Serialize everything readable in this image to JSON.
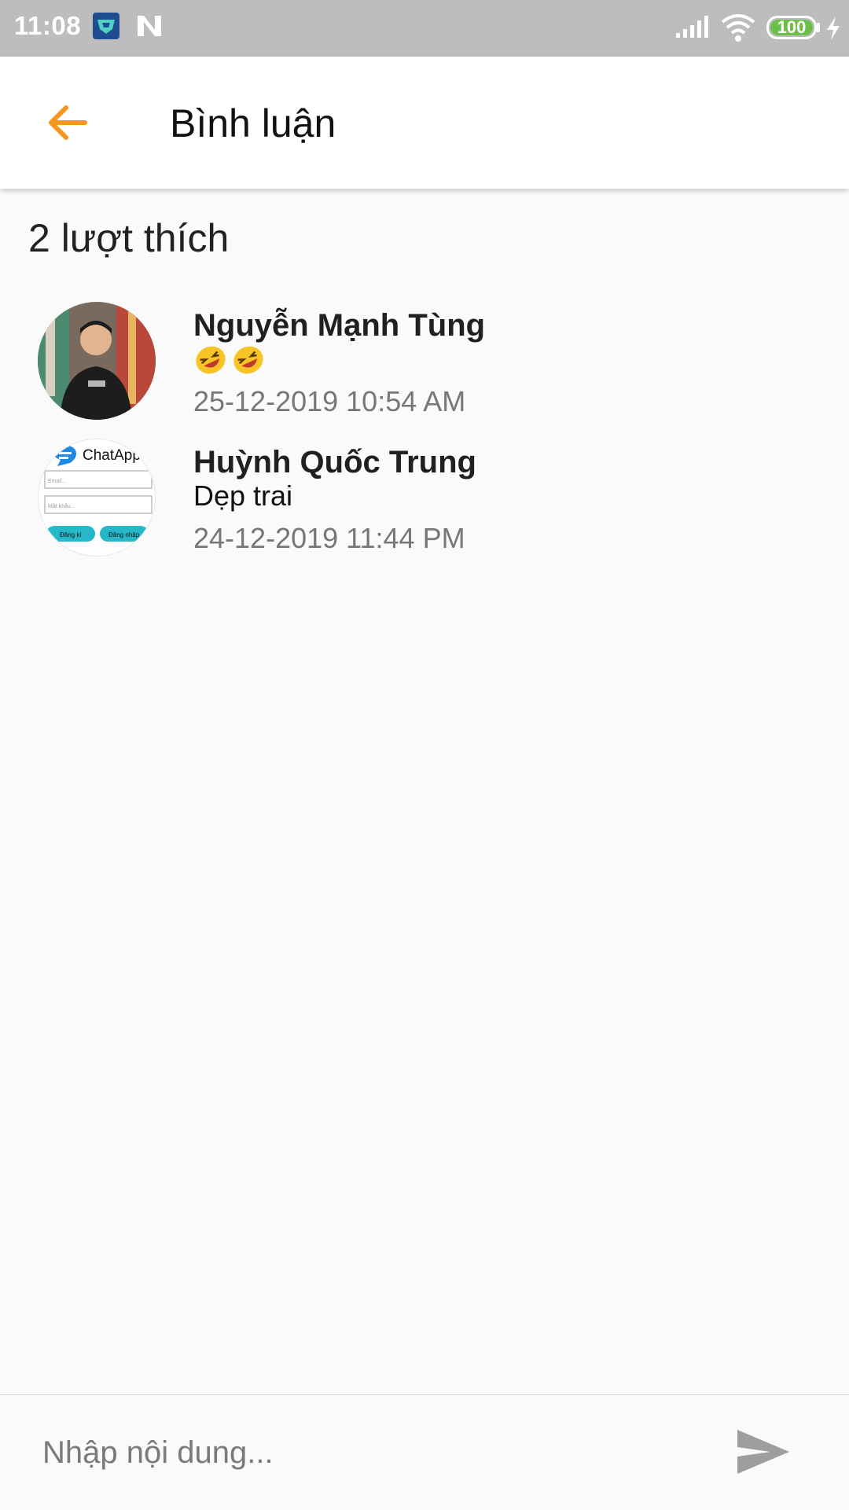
{
  "status_bar": {
    "time": "11:08",
    "battery": "100",
    "icons": [
      "app-icon",
      "n-icon",
      "signal-icon",
      "wifi-icon",
      "battery-icon",
      "charging-bolt-icon"
    ]
  },
  "header": {
    "title": "Bình luận",
    "back_icon": "arrow-left-icon",
    "accent_color": "#f5961e"
  },
  "likes": {
    "label": "2 lượt thích"
  },
  "comments": [
    {
      "name": "Nguyễn Mạnh Tùng",
      "text": "🤣🤣",
      "time": "25-12-2019 10:54 AM"
    },
    {
      "name": "Huỳnh Quốc Trung",
      "text": "Dẹp trai",
      "time": "24-12-2019 11:44 PM",
      "avatar_text": {
        "app_name": "ChatApp",
        "email_placeholder": "Email...",
        "password_placeholder": "Mật khẩu...",
        "register_button": "Đăng kí",
        "login_button": "Đăng nhập"
      }
    }
  ],
  "composer": {
    "placeholder": "Nhập nội dung...",
    "value": "",
    "send_icon": "send-icon"
  }
}
